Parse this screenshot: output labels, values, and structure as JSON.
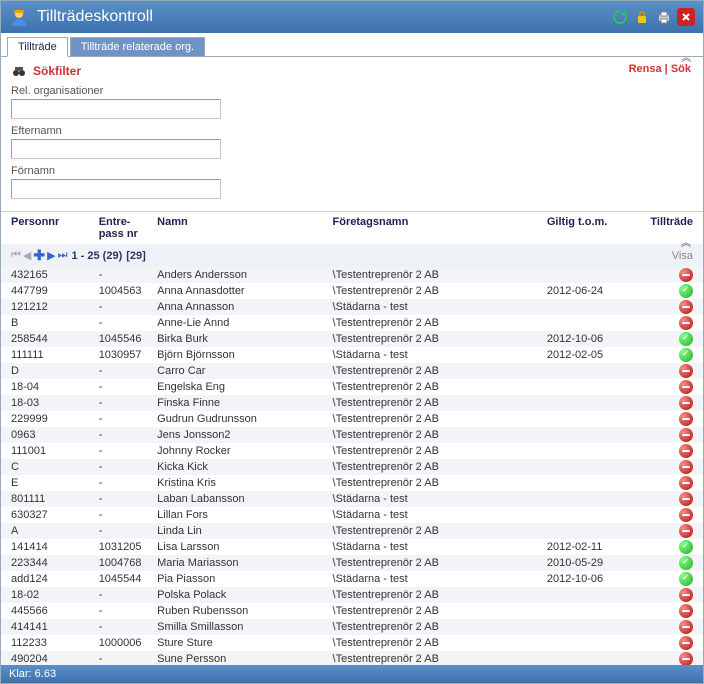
{
  "title": "Tillträdeskontroll",
  "tabs": [
    {
      "label": "Tillträde",
      "active": true
    },
    {
      "label": "Tillträde relaterade org.",
      "active": false
    }
  ],
  "filter": {
    "heading": "Sökfilter",
    "links": {
      "clear": "Rensa",
      "sep": " | ",
      "search": "Sök"
    },
    "fields": {
      "rel_org": {
        "label": "Rel. organisationer",
        "value": ""
      },
      "efternamn": {
        "label": "Efternamn",
        "value": ""
      },
      "fornamn": {
        "label": "Förnamn",
        "value": ""
      }
    }
  },
  "columns": {
    "personnr": "Personnr",
    "entre": "Entre-\npass nr",
    "namn": "Namn",
    "foretag": "Företagsnamn",
    "giltig": "Giltig t.o.m.",
    "tilltrade": "Tillträde"
  },
  "pager": {
    "range": "1 - 25 (29)",
    "pages": "[29]",
    "visa": "Visa"
  },
  "rows": [
    {
      "personnr": "432165",
      "entre": "-",
      "namn": "Anders Andersson",
      "foretag": "\\Testentreprenör 2 AB",
      "giltig": "",
      "status": "no"
    },
    {
      "personnr": "447799",
      "entre": "1004563",
      "namn": "Anna Annasdotter",
      "foretag": "\\Testentreprenör 2 AB",
      "giltig": "2012-06-24",
      "status": "ok"
    },
    {
      "personnr": "121212",
      "entre": "-",
      "namn": "Anna Annasson",
      "foretag": "\\Städarna - test",
      "giltig": "",
      "status": "no"
    },
    {
      "personnr": "B",
      "entre": "-",
      "namn": "Anne-Lie Annd",
      "foretag": "\\Testentreprenör 2 AB",
      "giltig": "",
      "status": "no"
    },
    {
      "personnr": "258544",
      "entre": "1045546",
      "namn": "Birka Burk",
      "foretag": "\\Testentreprenör 2 AB",
      "giltig": "2012-10-06",
      "status": "ok"
    },
    {
      "personnr": "111111",
      "entre": "1030957",
      "namn": "Björn Björnsson",
      "foretag": "\\Städarna - test",
      "giltig": "2012-02-05",
      "status": "ok"
    },
    {
      "personnr": "D",
      "entre": "-",
      "namn": "Carro Car",
      "foretag": "\\Testentreprenör 2 AB",
      "giltig": "",
      "status": "no"
    },
    {
      "personnr": "18-04",
      "entre": "-",
      "namn": "Engelska Eng",
      "foretag": "\\Testentreprenör 2 AB",
      "giltig": "",
      "status": "no"
    },
    {
      "personnr": "18-03",
      "entre": "-",
      "namn": "Finska Finne",
      "foretag": "\\Testentreprenör 2 AB",
      "giltig": "",
      "status": "no"
    },
    {
      "personnr": "229999",
      "entre": "-",
      "namn": "Gudrun Gudrunsson",
      "foretag": "\\Testentreprenör 2 AB",
      "giltig": "",
      "status": "no"
    },
    {
      "personnr": "0963",
      "entre": "-",
      "namn": "Jens Jonsson2",
      "foretag": "\\Testentreprenör 2 AB",
      "giltig": "",
      "status": "no"
    },
    {
      "personnr": "111001",
      "entre": "-",
      "namn": "Johnny Rocker",
      "foretag": "\\Testentreprenör 2 AB",
      "giltig": "",
      "status": "no"
    },
    {
      "personnr": "C",
      "entre": "-",
      "namn": "Kicka Kick",
      "foretag": "\\Testentreprenör 2 AB",
      "giltig": "",
      "status": "no"
    },
    {
      "personnr": "E",
      "entre": "-",
      "namn": "Kristina Kris",
      "foretag": "\\Testentreprenör 2 AB",
      "giltig": "",
      "status": "no"
    },
    {
      "personnr": "801111",
      "entre": "-",
      "namn": "Laban Labansson",
      "foretag": "\\Städarna - test",
      "giltig": "",
      "status": "no"
    },
    {
      "personnr": "630327",
      "entre": "-",
      "namn": "Lillan Fors",
      "foretag": "\\Städarna - test",
      "giltig": "",
      "status": "no"
    },
    {
      "personnr": "A",
      "entre": "-",
      "namn": "Linda Lin",
      "foretag": "\\Testentreprenör 2 AB",
      "giltig": "",
      "status": "no"
    },
    {
      "personnr": "141414",
      "entre": "1031205",
      "namn": "Lisa Larsson",
      "foretag": "\\Städarna - test",
      "giltig": "2012-02-11",
      "status": "ok"
    },
    {
      "personnr": "223344",
      "entre": "1004768",
      "namn": "Maria Mariasson",
      "foretag": "\\Testentreprenör 2 AB",
      "giltig": "2010-05-29",
      "status": "ok"
    },
    {
      "personnr": "add124",
      "entre": "1045544",
      "namn": "Pia Piasson",
      "foretag": "\\Städarna - test",
      "giltig": "2012-10-06",
      "status": "ok"
    },
    {
      "personnr": "18-02",
      "entre": "-",
      "namn": "Polska Polack",
      "foretag": "\\Testentreprenör 2 AB",
      "giltig": "",
      "status": "no"
    },
    {
      "personnr": "445566",
      "entre": "-",
      "namn": "Ruben Rubensson",
      "foretag": "\\Testentreprenör 2 AB",
      "giltig": "",
      "status": "no"
    },
    {
      "personnr": "414141",
      "entre": "-",
      "namn": "Smilla Smillasson",
      "foretag": "\\Testentreprenör 2 AB",
      "giltig": "",
      "status": "no"
    },
    {
      "personnr": "112233",
      "entre": "1000006",
      "namn": "Sture Sture",
      "foretag": "\\Testentreprenör 2 AB",
      "giltig": "",
      "status": "no"
    },
    {
      "personnr": "490204",
      "entre": "-",
      "namn": "Sune Persson",
      "foretag": "\\Testentreprenör 2 AB",
      "giltig": "",
      "status": "no"
    }
  ],
  "status_bar": "Klar: 6.63"
}
